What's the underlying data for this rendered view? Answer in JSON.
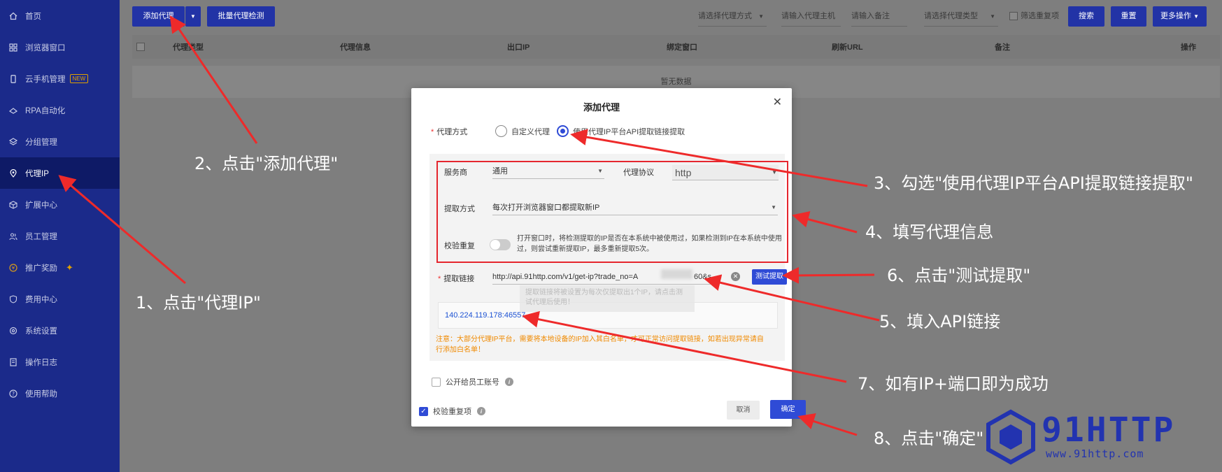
{
  "sidebar": {
    "items": [
      {
        "label": "首页",
        "icon": "home-icon"
      },
      {
        "label": "浏览器窗口",
        "icon": "grid-icon"
      },
      {
        "label": "云手机管理",
        "icon": "phone-icon",
        "badge": "NEW"
      },
      {
        "label": "RPA自动化",
        "icon": "robot-icon"
      },
      {
        "label": "分组管理",
        "icon": "layers-icon"
      },
      {
        "label": "代理IP",
        "icon": "location-icon",
        "active": true
      },
      {
        "label": "扩展中心",
        "icon": "cube-icon"
      },
      {
        "label": "员工管理",
        "icon": "users-icon"
      },
      {
        "label": "推广奖励",
        "icon": "gift-icon"
      },
      {
        "label": "费用中心",
        "icon": "shield-icon"
      },
      {
        "label": "系统设置",
        "icon": "settings-icon"
      },
      {
        "label": "操作日志",
        "icon": "log-icon"
      },
      {
        "label": "使用帮助",
        "icon": "help-icon"
      }
    ]
  },
  "toolbar": {
    "add_proxy": "添加代理",
    "batch_check": "批量代理检测",
    "proxy_method_placeholder": "请选择代理方式",
    "host_placeholder": "请输入代理主机",
    "remark_placeholder": "请输入备注",
    "proxy_type_placeholder": "请选择代理类型",
    "filter_dup": "筛选重复项",
    "search": "搜索",
    "reset": "重置",
    "more": "更多操作"
  },
  "table": {
    "headers": [
      "代理类型",
      "代理信息",
      "出口IP",
      "绑定窗口",
      "刷新URL",
      "备注",
      "操作"
    ],
    "empty": "暂无数据"
  },
  "modal": {
    "title": "添加代理",
    "proxy_method_label": "代理方式",
    "option_custom": "自定义代理",
    "option_api": "使用代理IP平台API提取链接提取",
    "provider_label": "服务商",
    "provider_value": "通用",
    "protocol_label": "代理协议",
    "protocol_value": "http",
    "extract_mode_label": "提取方式",
    "extract_mode_value": "每次打开浏览器窗口都提取新IP",
    "verify_dup_label": "校验重复",
    "verify_dup_desc": "打开窗口时，将检测提取的IP是否在本系统中被使用过，如果检测到IP在本系统中使用过，则尝试重新提取IP，最多重新提取5次。",
    "extract_link_label": "提取链接",
    "extract_link_value": "http://api.91http.com/v1/get-ip?trade_no=A",
    "extract_link_tail": "60&s",
    "test_button": "测试提取",
    "tooltip_text": "提取链接将被设置为每次仅提取出1个IP，请点击测试代理后使用！",
    "result_ip": "140.224.119.178:46557",
    "warning": "注意：大部分代理IP平台，需要将本地设备的IP加入其白名单，才可正常访问提取链接，如若出现异常请自行添加白名单！",
    "share_label": "公开给员工账号",
    "verify_footer": "校验重复项",
    "cancel": "取消",
    "confirm": "确定"
  },
  "annotations": {
    "step1": "1、点击\"代理IP\"",
    "step2": "2、点击\"添加代理\"",
    "step3": "3、勾选\"使用代理IP平台API提取链接提取\"",
    "step4": "4、填写代理信息",
    "step5": "5、填入API链接",
    "step6": "6、点击\"测试提取\"",
    "step7": "7、如有IP+端口即为成功",
    "step8": "8、点击\"确定\""
  },
  "logo": {
    "name": "91HTTP",
    "url": "www.91http.com"
  },
  "colors": {
    "sidebar": "#1b2a8a",
    "primary": "#2f4bd6",
    "annotation_arrow": "#ee2a2a",
    "warning": "#f08a00"
  }
}
